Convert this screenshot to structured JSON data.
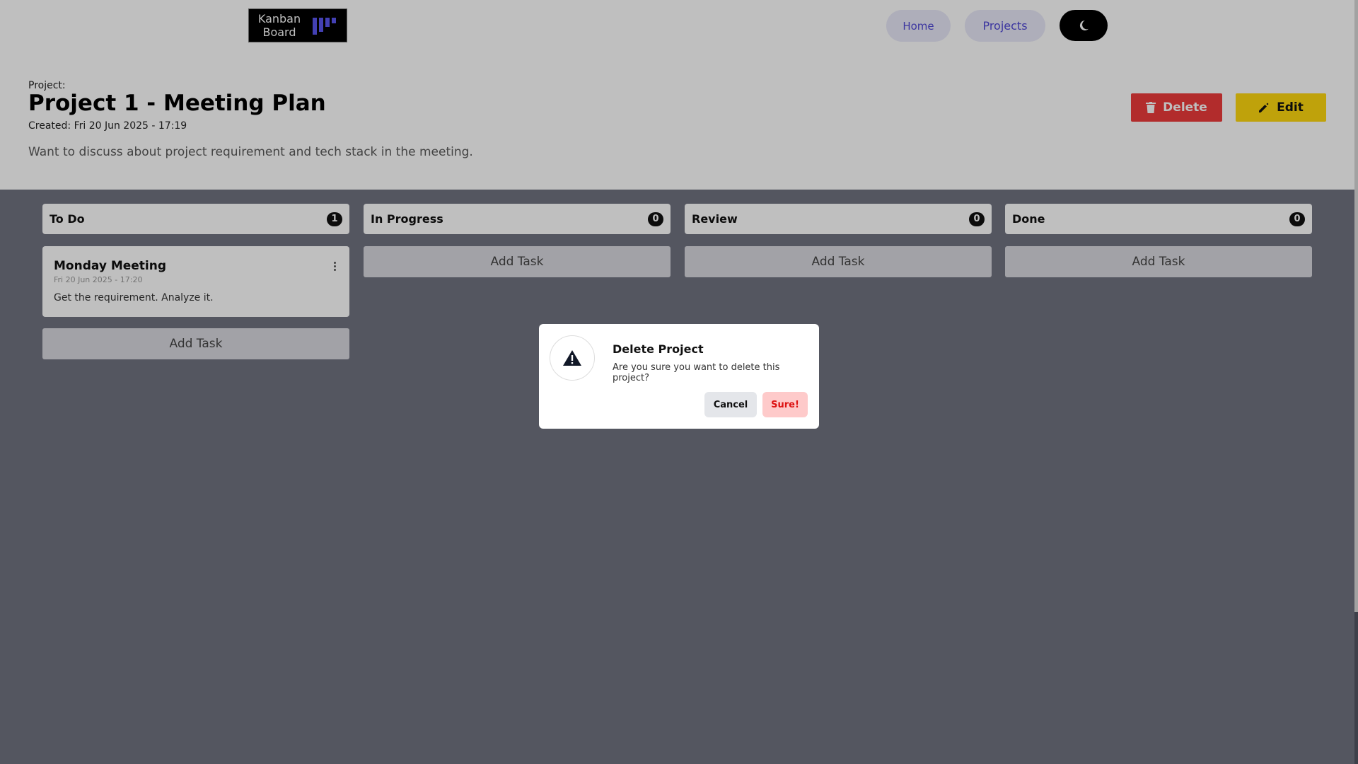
{
  "header": {
    "logo_text_line1": "Kanban",
    "logo_text_line2": "Board",
    "nav": {
      "home": "Home",
      "projects": "Projects"
    },
    "theme_toggle_icon": "moon-icon"
  },
  "project": {
    "label": "Project:",
    "title": "Project 1 - Meeting Plan",
    "created": "Created: Fri 20 Jun 2025 - 17:19",
    "description": "Want to discuss about project requirement and tech stack in the meeting.",
    "delete_label": "Delete",
    "edit_label": "Edit"
  },
  "columns": [
    {
      "name": "To Do",
      "count": "1"
    },
    {
      "name": "In Progress",
      "count": "0"
    },
    {
      "name": "Review",
      "count": "0"
    },
    {
      "name": "Done",
      "count": "0"
    }
  ],
  "add_task_label": "Add Task",
  "tasks": [
    {
      "title": "Monday Meeting",
      "date": "Fri 20 Jun 2025 - 17:20",
      "description": "Get the requirement. Analyze it."
    }
  ],
  "modal": {
    "title": "Delete Project",
    "message": "Are you sure you want to delete this project?",
    "cancel_label": "Cancel",
    "confirm_label": "Sure!"
  },
  "colors": {
    "delete": "#ee3b3b",
    "edit": "#ffd90f",
    "accent": "#5148d6",
    "confirm_bg": "#fecaca"
  }
}
